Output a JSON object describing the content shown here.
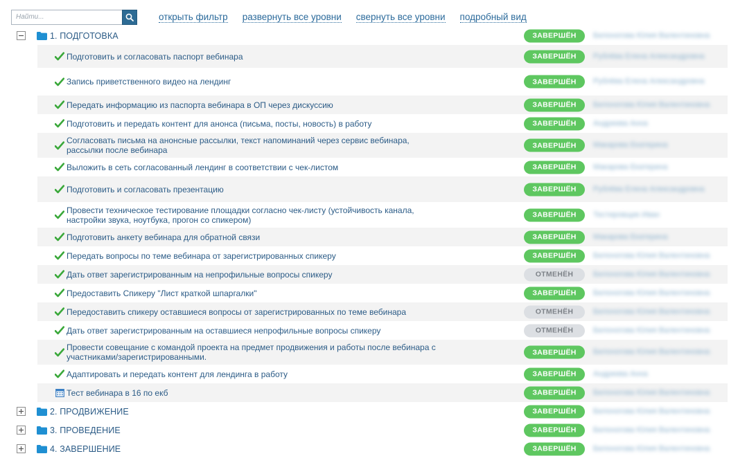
{
  "toolbar": {
    "search_placeholder": "Найти...",
    "links": [
      "открыть фильтр",
      "развернуть все уровни",
      "свернуть все уровни",
      "подробный вид"
    ]
  },
  "colors": {
    "done": "#5ec760",
    "cancel": "#dcdfe3",
    "link": "#2b6a9b",
    "folder": "#1f8fd2"
  },
  "tree": {
    "groups": [
      {
        "title": "1. ПОДГОТОВКА",
        "expanded": true,
        "status": "ЗАВЕРШЁН",
        "assignee": "Белоногова Юлия Валентиновна",
        "tasks": [
          {
            "text": "Подготовить и согласовать паспорт вебинара",
            "status": "ЗАВЕРШЁН",
            "assignee": "Рублёва Елена Александровна",
            "icon": "check-icon"
          },
          {
            "text": "Запись приветственного видео на лендинг",
            "status": "ЗАВЕРШЁН",
            "assignee": "Рублёва Елена Александровна",
            "icon": "check-icon"
          },
          {
            "text": "Передать информацию из паспорта вебинара в ОП через дискуссию",
            "status": "ЗАВЕРШЁН",
            "assignee": "Белоногова Юлия Валентиновна",
            "icon": "check-icon"
          },
          {
            "text": "Подготовить и передать контент для анонса (письма, посты, новость) в работу",
            "status": "ЗАВЕРШЁН",
            "assignee": "Андреева Анна",
            "icon": "check-icon"
          },
          {
            "text": "Согласовать письма на анонсные рассылки, текст напоминаний через сервис вебинара, рассылки после вебинара",
            "status": "ЗАВЕРШЁН",
            "assignee": "Макарова Екатерина",
            "icon": "check-icon"
          },
          {
            "text": "Выложить в сеть согласованный лендинг в соответствии с чек-листом",
            "status": "ЗАВЕРШЁН",
            "assignee": "Макарова Екатерина",
            "icon": "check-icon"
          },
          {
            "text": "Подготовить и согласовать презентацию",
            "status": "ЗАВЕРШЁН",
            "assignee": "Рублёва Елена Александровна",
            "icon": "check-icon"
          },
          {
            "text": "Провести техническое тестирование площадки согласно чек-листу (устойчивость канала, настройки звука, ноутбука, прогон со спикером)",
            "status": "ЗАВЕРШЁН",
            "assignee": "Тестировщик Иван",
            "icon": "check-icon"
          },
          {
            "text": "Подготовить анкету вебинара для обратной связи",
            "status": "ЗАВЕРШЁН",
            "assignee": "Макарова Екатерина",
            "icon": "check-icon"
          },
          {
            "text": "Передать вопросы по теме вебинара от зарегистрированных спикеру",
            "status": "ЗАВЕРШЁН",
            "assignee": "Белоногова Юлия Валентиновна",
            "icon": "check-icon"
          },
          {
            "text": "Дать ответ зарегистрированным на непрофильные вопросы спикеру",
            "status": "ОТМЕНЁН",
            "assignee": "Белоногова Юлия Валентиновна",
            "icon": "check-icon"
          },
          {
            "text": "Предоставить Спикеру \"Лист краткой шпаргалки\"",
            "status": "ЗАВЕРШЁН",
            "assignee": "Белоногова Юлия Валентиновна",
            "icon": "check-icon"
          },
          {
            "text": "Передоставить спикеру оставшиеся вопросы от зарегистрированных по теме вебинара",
            "status": "ОТМЕНЁН",
            "assignee": "Белоногова Юлия Валентиновна",
            "icon": "check-icon"
          },
          {
            "text": "Дать ответ зарегистрированным на оставшиеся непрофильные вопросы спикеру",
            "status": "ОТМЕНЁН",
            "assignee": "Белоногова Юлия Валентиновна",
            "icon": "check-icon"
          },
          {
            "text": "Провести совещание с командой проекта на предмет продвижения и работы после вебинара с участниками/зарегистрированными.",
            "status": "ЗАВЕРШЁН",
            "assignee": "Белоногова Юлия Валентиновна",
            "icon": "check-icon"
          },
          {
            "text": "Адаптировать и передать контент для лендинга в работу",
            "status": "ЗАВЕРШЁН",
            "assignee": "Андреева Анна",
            "icon": "check-icon"
          },
          {
            "text": "Тест вебинара в 16 по екб",
            "status": "ЗАВЕРШЁН",
            "assignee": "Белоногова Юлия Валентиновна",
            "icon": "calendar-icon"
          }
        ]
      },
      {
        "title": "2. ПРОДВИЖЕНИЕ",
        "expanded": false,
        "status": "ЗАВЕРШЁН",
        "assignee": "Белоногова Юлия Валентиновна",
        "tasks": []
      },
      {
        "title": "3. ПРОВЕДЕНИЕ",
        "expanded": false,
        "status": "ЗАВЕРШЁН",
        "assignee": "Белоногова Юлия Валентиновна",
        "tasks": []
      },
      {
        "title": "4. ЗАВЕРШЕНИЕ",
        "expanded": false,
        "status": "ЗАВЕРШЁН",
        "assignee": "Белоногова Юлия Валентиновна",
        "tasks": []
      }
    ]
  }
}
